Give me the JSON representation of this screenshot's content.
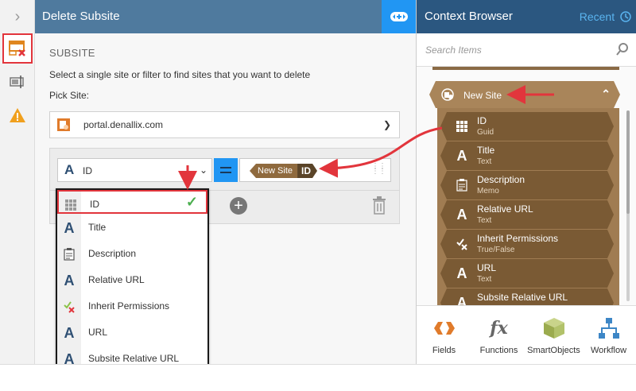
{
  "center": {
    "title": "Delete Subsite",
    "section_title": "SUBSITE",
    "description": "Select a single site or filter to find sites that you want to delete",
    "pick_label": "Pick Site:",
    "pick_value": "portal.denallix.com",
    "filter": {
      "field": "ID",
      "operator_icon": "equals-icon",
      "value_token": {
        "object": "New Site",
        "field": "ID"
      }
    }
  },
  "dropdown": {
    "items": [
      {
        "label": "ID",
        "icon": "grid-icon",
        "selected": true
      },
      {
        "label": "Title",
        "icon": "text-a-icon"
      },
      {
        "label": "Description",
        "icon": "memo-icon"
      },
      {
        "label": "Relative URL",
        "icon": "text-a-icon"
      },
      {
        "label": "Inherit Permissions",
        "icon": "truefalse-icon"
      },
      {
        "label": "URL",
        "icon": "text-a-icon"
      },
      {
        "label": "Subsite Relative URL",
        "icon": "text-a-icon"
      }
    ]
  },
  "context": {
    "title": "Context Browser",
    "recent": "Recent",
    "search_placeholder": "Search Items",
    "parent": "New Site",
    "children": [
      {
        "name": "ID",
        "type": "Guid",
        "icon": "grid-icon"
      },
      {
        "name": "Title",
        "type": "Text",
        "icon": "text-a-icon"
      },
      {
        "name": "Description",
        "type": "Memo",
        "icon": "memo-icon"
      },
      {
        "name": "Relative URL",
        "type": "Text",
        "icon": "text-a-icon"
      },
      {
        "name": "Inherit Permissions",
        "type": "True/False",
        "icon": "truefalse-icon"
      },
      {
        "name": "URL",
        "type": "Text",
        "icon": "text-a-icon"
      },
      {
        "name": "Subsite Relative URL",
        "type": "",
        "icon": "text-a-icon"
      }
    ],
    "toolbar": [
      {
        "label": "Fields",
        "icon": "fields-icon"
      },
      {
        "label": "Functions",
        "icon": "fx-icon"
      },
      {
        "label": "SmartObjects",
        "icon": "cube-icon"
      },
      {
        "label": "Workflow",
        "icon": "workflow-icon"
      }
    ]
  },
  "colors": {
    "center_header": "#4f7a9e",
    "right_header": "#2b5780",
    "accent_blue": "#2196f3",
    "annotation_red": "#e2353c",
    "tree_brown": "#a9855a"
  }
}
